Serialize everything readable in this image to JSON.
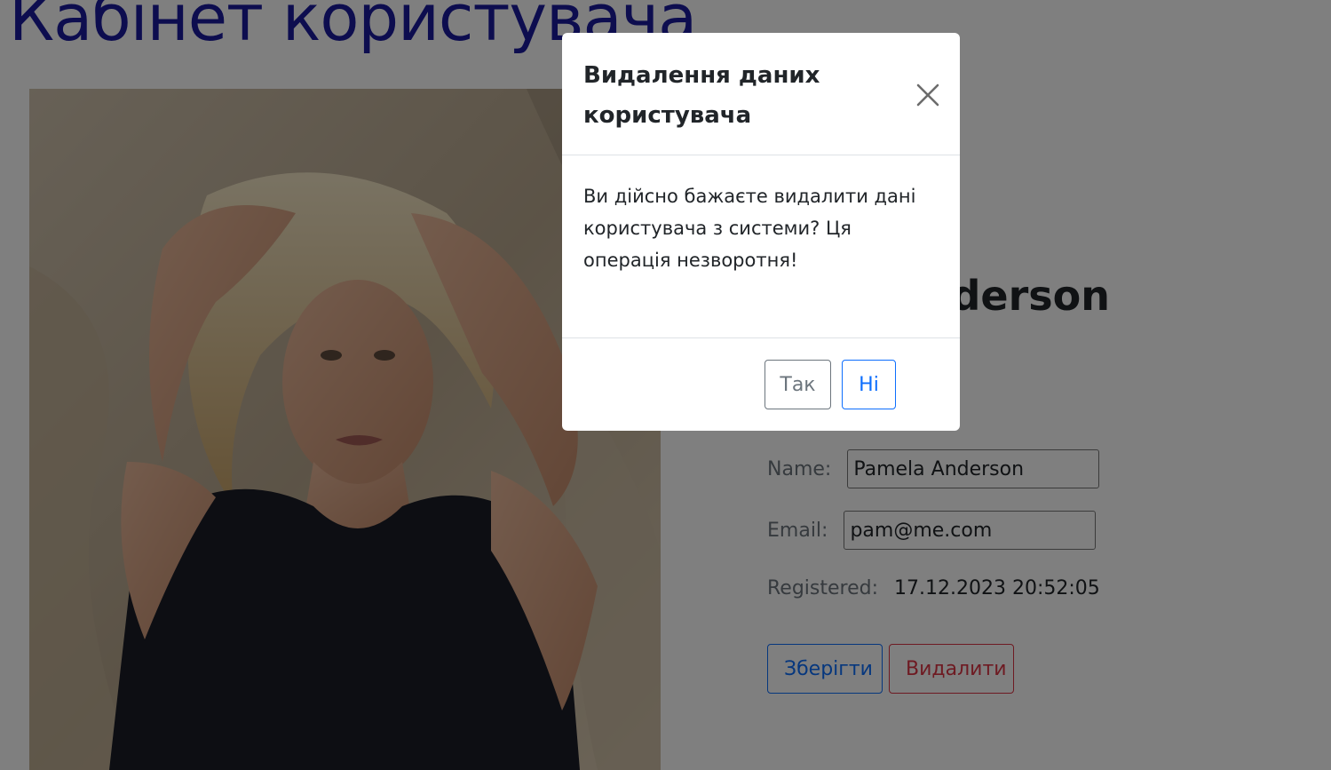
{
  "page": {
    "title": "Кабінет користувача"
  },
  "profile": {
    "user_name": "Pamela Anderson",
    "fields": {
      "name_label": "Name:",
      "name_value": "Pamela Anderson",
      "email_label": "Email:",
      "email_value": "pam@me.com",
      "registered_label": "Registered:",
      "registered_value": "17.12.2023 20:52:05"
    },
    "actions": {
      "save_label": "Зберігти",
      "delete_label": "Видалити"
    }
  },
  "modal": {
    "title": "Видалення даних користувача",
    "body": "Ви дійсно бажаєте видалити дані користувача з системи? Ця операція незворотня!",
    "yes_label": "Так",
    "no_label": "Ні",
    "close_icon": "close-icon"
  },
  "colors": {
    "title": "#1a1a9e",
    "primary": "#0d6efd",
    "danger": "#dc3545",
    "secondary": "#6c757d",
    "backdrop": "rgba(0,0,0,0.5)"
  }
}
